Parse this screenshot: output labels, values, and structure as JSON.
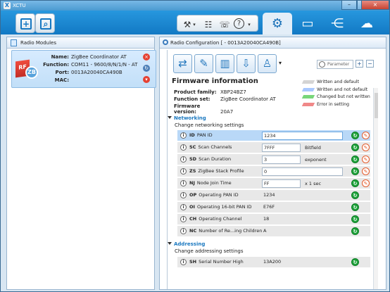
{
  "window": {
    "title": "XCTU",
    "logo_icon": "xctu-logo-icon",
    "controls": {
      "minimize": "–",
      "maximize": "□",
      "close": "×"
    }
  },
  "toolbar": {
    "left_buttons": [
      {
        "icon": "add-radio-icon",
        "glyph": "+"
      },
      {
        "icon": "discover-radio-icon",
        "glyph": "⌕"
      }
    ],
    "tools_buttons": [
      {
        "icon": "tools-icon",
        "glyph": "⚒",
        "dropdown": "▾"
      },
      {
        "icon": "list-config-icon",
        "glyph": "☷",
        "dropdown": ""
      },
      {
        "icon": "chat-icon",
        "glyph": "☏",
        "dropdown": ""
      },
      {
        "icon": "help-icon",
        "glyph": "?",
        "dropdown": "▾"
      }
    ],
    "tabs": [
      {
        "icon": "configuration-gear-icon",
        "glyph": "⚙",
        "active": true
      },
      {
        "icon": "console-monitor-icon",
        "glyph": "▭",
        "active": false
      },
      {
        "icon": "network-icon",
        "glyph": "⋲",
        "active": false
      },
      {
        "icon": "cloud-icon",
        "glyph": "☁",
        "active": false
      }
    ]
  },
  "left_panel": {
    "title": "Radio Modules",
    "module": {
      "labels": [
        "Name:",
        "Function:",
        "Port:",
        "MAC:"
      ],
      "values": [
        "",
        "ZigBee Coordinator AT",
        "COM11 - 9600/8/N/1/N - AT",
        "0013A20040CA490B"
      ],
      "icon_text": {
        "rf": "RF",
        "zb": "ZB"
      },
      "actions": [
        {
          "icon": "remove-icon",
          "glyph": "×",
          "color": "#e54133"
        },
        {
          "icon": "refresh-icon",
          "glyph": "↻",
          "color": "#4d7fb7"
        },
        {
          "icon": "dropdown-icon",
          "glyph": "▾",
          "color": "#e54133"
        }
      ]
    }
  },
  "right_panel": {
    "title": "Radio Configuration [  - 0013A20040CA490B]",
    "toolbar": {
      "buttons": [
        {
          "icon": "read-icon",
          "glyph": "⇄"
        },
        {
          "icon": "write-icon",
          "glyph": "✎"
        },
        {
          "icon": "default-icon",
          "glyph": "▥"
        },
        {
          "icon": "update-icon",
          "glyph": "⇩"
        },
        {
          "icon": "profile-icon",
          "glyph": "♙"
        }
      ],
      "profile_dropdown": "▾",
      "search_placeholder": "Parameter",
      "expand_icon": "+",
      "collapse_icon": "−"
    },
    "firmware": {
      "title": "Firmware information",
      "rows": [
        {
          "label": "Product family:",
          "value": "XBP24BZ7"
        },
        {
          "label": "Function set:",
          "value": "ZigBee Coordinator AT"
        },
        {
          "label": "Firmware version:",
          "value": "20A7"
        }
      ]
    },
    "legend": [
      {
        "label": "Written and default",
        "color": "#d4d4d4"
      },
      {
        "label": "Written and not default",
        "color": "#a9c8ff"
      },
      {
        "label": "Changed but not written",
        "color": "#78d67a"
      },
      {
        "label": "Error in setting",
        "color": "#f08888"
      }
    ],
    "sections": [
      {
        "title": "Networking",
        "description": "Change networking settings",
        "params": [
          {
            "code": "ID",
            "name": "PAN ID",
            "value": "1234",
            "unit": "",
            "box": true,
            "wide": true,
            "selected": true,
            "write": true
          },
          {
            "code": "SC",
            "name": "Scan Channels",
            "value": "7FFF",
            "unit": "Bitfield",
            "box": true,
            "wide": false,
            "selected": false,
            "write": true
          },
          {
            "code": "SD",
            "name": "Scan Duration",
            "value": "3",
            "unit": "exponent",
            "box": true,
            "wide": false,
            "selected": false,
            "write": true
          },
          {
            "code": "ZS",
            "name": "ZigBee Stack Profile",
            "value": "0",
            "unit": "",
            "box": true,
            "wide": true,
            "selected": false,
            "write": true
          },
          {
            "code": "NJ",
            "name": "Node Join Time",
            "value": "FF",
            "unit": "x 1 sec",
            "box": true,
            "wide": false,
            "selected": false,
            "write": true
          },
          {
            "code": "OP",
            "name": "Operating PAN ID",
            "value": "1234",
            "unit": "",
            "box": false,
            "wide": false,
            "selected": false,
            "write": false
          },
          {
            "code": "OI",
            "name": "Operating 16-bit PAN ID",
            "value": "E76F",
            "unit": "",
            "box": false,
            "wide": false,
            "selected": false,
            "write": false
          },
          {
            "code": "CH",
            "name": "Operating Channel",
            "value": "18",
            "unit": "",
            "box": false,
            "wide": false,
            "selected": false,
            "write": false
          },
          {
            "code": "NC",
            "name": "Number of Re...ing Children",
            "value": "A",
            "unit": "",
            "box": false,
            "wide": false,
            "selected": false,
            "write": false
          }
        ]
      },
      {
        "title": "Addressing",
        "description": "Change addressing settings",
        "params": [
          {
            "code": "SH",
            "name": "Serial Number High",
            "value": "13A200",
            "unit": "",
            "box": false,
            "wide": false,
            "selected": false,
            "write": false
          }
        ]
      }
    ],
    "row_buttons": {
      "read": "↻",
      "write": "✎",
      "info": "i"
    }
  }
}
